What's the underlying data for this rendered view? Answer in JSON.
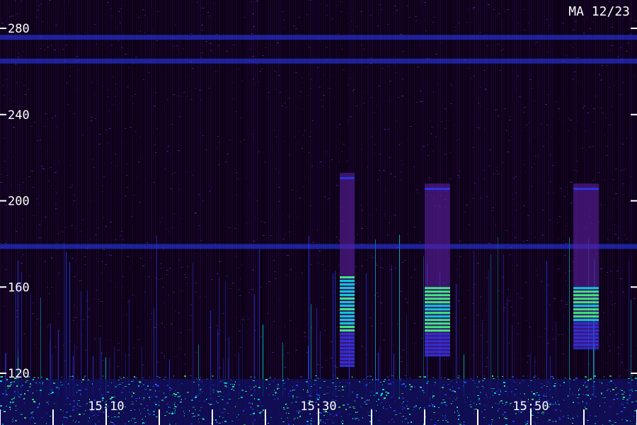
{
  "chart_data": {
    "type": "heatmap",
    "title": "MA 12/23",
    "xlabel": "",
    "ylabel": "",
    "x_tick_labels": [
      "15:10",
      "15:30",
      "15:50"
    ],
    "y_tick_labels": [
      "120",
      "160",
      "200",
      "240",
      "280"
    ],
    "y_ticks": [
      120,
      160,
      200,
      240,
      280
    ],
    "ylim": [
      98,
      293
    ],
    "colors": {
      "background": "#0a0012",
      "noise_low": "#2a0a4a",
      "noise_high": "#5a1fa0",
      "blue": "#2a3cff",
      "cyan": "#00e0e0",
      "green": "#40ff80",
      "text": "#ffffff"
    },
    "bursts": [
      {
        "id": "burst-1",
        "x_range": [
          "15:32",
          "15:33"
        ],
        "y_range": [
          123,
          213
        ],
        "peak_y_range": [
          140,
          165
        ]
      },
      {
        "id": "burst-2",
        "x_range": [
          "15:40",
          "15:42"
        ],
        "y_range": [
          128,
          208
        ],
        "peak_y_range": [
          140,
          160
        ]
      },
      {
        "id": "burst-3",
        "x_range": [
          "15:54",
          "15:56"
        ],
        "y_range": [
          132,
          208
        ],
        "peak_y_range": [
          145,
          160
        ]
      }
    ],
    "horizontal_lines": [
      {
        "id": "line-179",
        "y": 179
      },
      {
        "id": "line-276",
        "y": 276
      },
      {
        "id": "line-265",
        "y": 265
      }
    ]
  }
}
